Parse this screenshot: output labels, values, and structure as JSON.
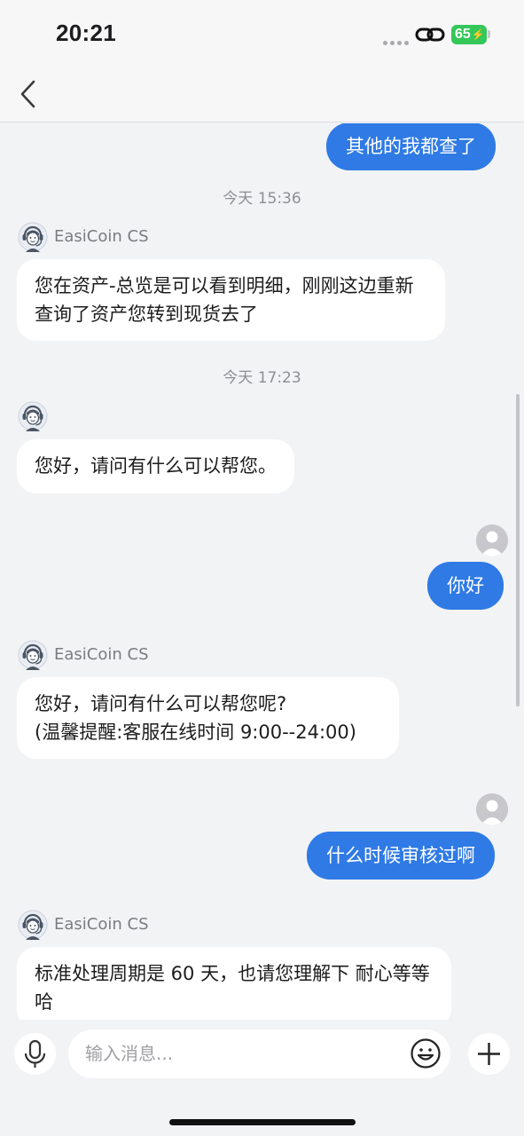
{
  "status_bar": {
    "time": "20:21",
    "battery": "65"
  },
  "agent_name": "EasiCoin CS",
  "messages": {
    "m1": "其他的我都查了",
    "t1": "今天 15:36",
    "m2": "您在资产-总览是可以看到明细，刚刚这边重新查询了资产您转到现货去了",
    "t2": "今天 17:23",
    "m3": "您好，请问有什么可以帮您。",
    "m4": "你好",
    "m5_line1": "您好，请问有什么可以帮您呢?",
    "m5_line2": "(温馨提醒:客服在线时间 9:00--24:00)",
    "m6": "什么时候审核过啊",
    "m7": "标准处理周期是 60 天，也请您理解下 耐心等等哈"
  },
  "input": {
    "placeholder": "输入消息..."
  },
  "icons": {
    "back": "chevron-left-icon",
    "agent": "cs-agent-avatar-icon",
    "user": "user-avatar-icon",
    "mic": "microphone-icon",
    "emoji": "smiley-icon",
    "plus": "plus-icon",
    "link": "link-icon"
  },
  "colors": {
    "accent": "#2f7ae5",
    "battery": "#34c759"
  }
}
